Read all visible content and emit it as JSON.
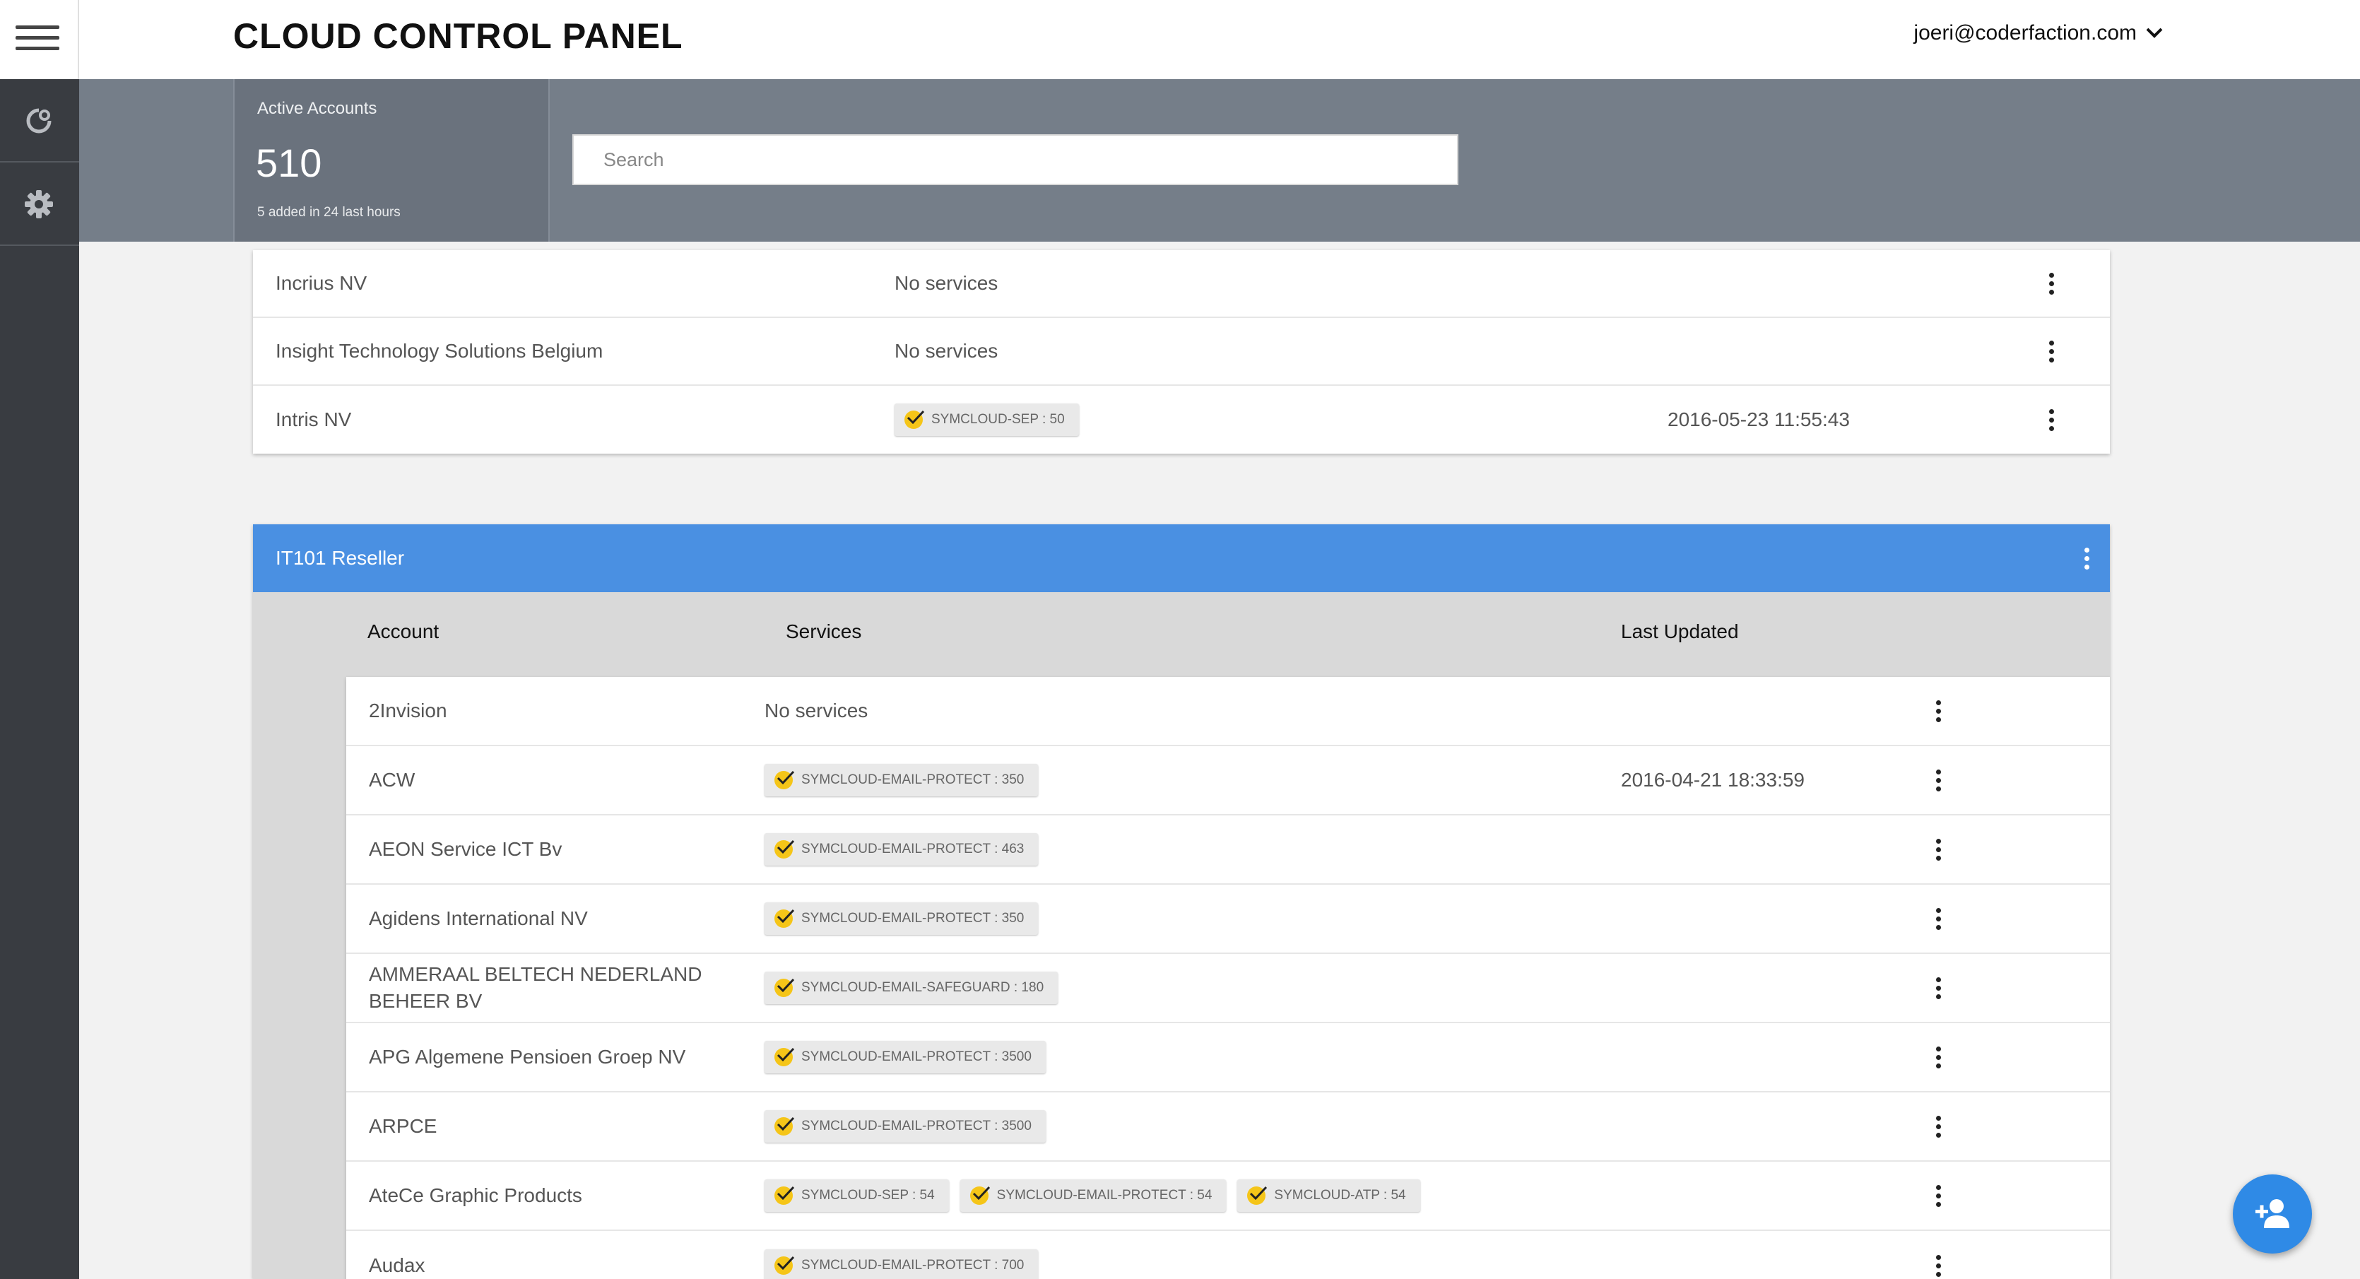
{
  "header": {
    "title": "CLOUD CONTROL PANEL",
    "user_email": "joeri@coderfaction.com"
  },
  "stats": {
    "label": "Active Accounts",
    "count": "510",
    "sub": "5 added in 24 last hours"
  },
  "search": {
    "placeholder": "Search"
  },
  "top_rows": [
    {
      "name": "Incrius NV",
      "services_text": "No services",
      "services": [],
      "date": ""
    },
    {
      "name": "Insight Technology Solutions Belgium",
      "services_text": "No services",
      "services": [],
      "date": ""
    },
    {
      "name": "Intris NV",
      "services_text": "",
      "services": [
        "SYMCLOUD-SEP : 50"
      ],
      "date": "2016-05-23 11:55:43"
    }
  ],
  "group": {
    "title": "IT101 Reseller",
    "columns": {
      "account": "Account",
      "services": "Services",
      "last_updated": "Last Updated"
    },
    "rows": [
      {
        "name": "2Invision",
        "services_text": "No services",
        "services": [],
        "date": ""
      },
      {
        "name": "ACW",
        "services_text": "",
        "services": [
          "SYMCLOUD-EMAIL-PROTECT : 350"
        ],
        "date": "2016-04-21 18:33:59"
      },
      {
        "name": "AEON Service ICT Bv",
        "services_text": "",
        "services": [
          "SYMCLOUD-EMAIL-PROTECT : 463"
        ],
        "date": ""
      },
      {
        "name": "Agidens International NV",
        "services_text": "",
        "services": [
          "SYMCLOUD-EMAIL-PROTECT : 350"
        ],
        "date": ""
      },
      {
        "name": "AMMERAAL BELTECH NEDERLAND BEHEER BV",
        "services_text": "",
        "services": [
          "SYMCLOUD-EMAIL-SAFEGUARD : 180"
        ],
        "date": ""
      },
      {
        "name": "APG Algemene Pensioen Groep NV",
        "services_text": "",
        "services": [
          "SYMCLOUD-EMAIL-PROTECT : 3500"
        ],
        "date": ""
      },
      {
        "name": "ARPCE",
        "services_text": "",
        "services": [
          "SYMCLOUD-EMAIL-PROTECT : 3500"
        ],
        "date": ""
      },
      {
        "name": "AteCe Graphic Products",
        "services_text": "",
        "services": [
          "SYMCLOUD-SEP : 54",
          "SYMCLOUD-EMAIL-PROTECT : 54",
          "SYMCLOUD-ATP : 54"
        ],
        "date": ""
      },
      {
        "name": "Audax",
        "services_text": "",
        "services": [
          "SYMCLOUD-EMAIL-PROTECT : 700"
        ],
        "date": ""
      }
    ]
  },
  "icons": {
    "menu": "hamburger-icon",
    "refresh": "refresh-icon",
    "settings": "gear-icon",
    "dropdown": "chevron-down-icon",
    "service": "check-badge-icon",
    "more": "more-vert-icon",
    "fab": "add-user-icon"
  },
  "colors": {
    "group_header": "#4a90e2",
    "stats_bar": "#757e89",
    "sidebar": "#393c41",
    "fab": "#2f8ae6",
    "service_badge": "#f5c518"
  }
}
